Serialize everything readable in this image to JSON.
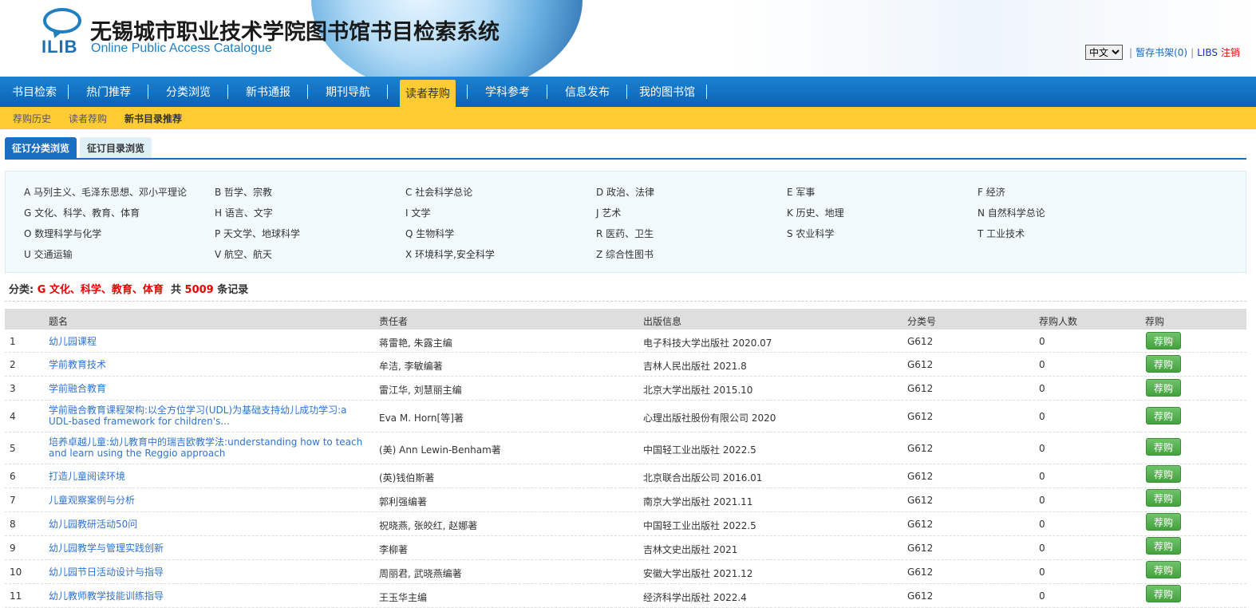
{
  "header": {
    "logo_text": "ILIB",
    "title": "无锡城市职业技术学院图书馆书目检索系统",
    "subtitle": "Online Public Access Catalogue",
    "language": "中文",
    "shelf_link": "暂存书架(0)",
    "libs_link": "LIBS",
    "logout_link": "注销"
  },
  "main_nav": [
    {
      "label": "书目检索",
      "active": false
    },
    {
      "label": "热门推荐",
      "active": false
    },
    {
      "label": "分类浏览",
      "active": false
    },
    {
      "label": "新书通报",
      "active": false
    },
    {
      "label": "期刊导航",
      "active": false
    },
    {
      "label": "读者荐购",
      "active": true
    },
    {
      "label": "学科参考",
      "active": false
    },
    {
      "label": "信息发布",
      "active": false
    },
    {
      "label": "我的图书馆",
      "active": false
    }
  ],
  "sub_nav": [
    {
      "label": "荐购历史"
    },
    {
      "label": "读者荐购"
    },
    {
      "label": "新书目录推荐"
    }
  ],
  "tabs": [
    {
      "label": "征订分类浏览"
    },
    {
      "label": "征订目录浏览"
    }
  ],
  "categories": [
    [
      "A 马列主义、毛泽东思想、邓小平理论",
      "B 哲学、宗教",
      "C 社会科学总论",
      "D 政治、法律",
      "E 军事",
      "F 经济"
    ],
    [
      "G 文化、科学、教育、体育",
      "H 语言、文字",
      "I 文学",
      "J 艺术",
      "K 历史、地理",
      "N 自然科学总论"
    ],
    [
      "O 数理科学与化学",
      "P 天文学、地球科学",
      "Q 生物科学",
      "R 医药、卫生",
      "S 农业科学",
      "T 工业技术"
    ],
    [
      "U 交通运输",
      "V 航空、航天",
      "X 环境科学,安全科学",
      "Z 综合性图书"
    ]
  ],
  "summary": {
    "prefix": "分类:",
    "category": "G 文化、科学、教育、体育",
    "total_prefix": "共",
    "count": "5009",
    "suffix": "条记录"
  },
  "table": {
    "headers": [
      "题名",
      "责任者",
      "出版信息",
      "分类号",
      "荐购人数",
      "荐购"
    ],
    "rows": [
      {
        "no": "1",
        "title": "幼儿园课程",
        "author": "蒋雷艳, 朱露主编",
        "pub": "电子科技大学出版社 2020.07",
        "class": "G612",
        "count": "0",
        "btn": "荐购"
      },
      {
        "no": "2",
        "title": "学前教育技术",
        "author": "牟洁, 李敏编著",
        "pub": "吉林人民出版社 2021.8",
        "class": "G612",
        "count": "0",
        "btn": "荐购"
      },
      {
        "no": "3",
        "title": "学前融合教育",
        "author": "雷江华, 刘慧丽主编",
        "pub": "北京大学出版社 2015.10",
        "class": "G612",
        "count": "0",
        "btn": "荐购"
      },
      {
        "no": "4",
        "title": "学前融合教育课程架构:以全方位学习(UDL)为基础支持幼儿成功学习:a UDL-based framework for children's...",
        "author": "Eva M. Horn[等]著",
        "pub": "心理出版社股份有限公司 2020",
        "class": "G612",
        "count": "0",
        "btn": "荐购"
      },
      {
        "no": "5",
        "title": "培养卓越儿童:幼儿教育中的瑞吉欧教学法:understanding how to teach and learn using the Reggio approach",
        "author": "(美) Ann Lewin-Benham著",
        "pub": "中国轻工业出版社 2022.5",
        "class": "G612",
        "count": "0",
        "btn": "荐购"
      },
      {
        "no": "6",
        "title": "打造儿童阅读环境",
        "author": "(英)钱伯斯著",
        "pub": "北京联合出版公司 2016.01",
        "class": "G612",
        "count": "0",
        "btn": "荐购"
      },
      {
        "no": "7",
        "title": "儿童观察案例与分析",
        "author": "郭利强编著",
        "pub": "南京大学出版社 2021.11",
        "class": "G612",
        "count": "0",
        "btn": "荐购"
      },
      {
        "no": "8",
        "title": "幼儿园教研活动50问",
        "author": "祝晓燕, 张皎红, 赵娜著",
        "pub": "中国轻工业出版社 2022.5",
        "class": "G612",
        "count": "0",
        "btn": "荐购"
      },
      {
        "no": "9",
        "title": "幼儿园教学与管理实践创新",
        "author": "李柳著",
        "pub": "吉林文史出版社 2021",
        "class": "G612",
        "count": "0",
        "btn": "荐购"
      },
      {
        "no": "10",
        "title": "幼儿园节日活动设计与指导",
        "author": "周丽君, 武晓燕编著",
        "pub": "安徽大学出版社 2021.12",
        "class": "G612",
        "count": "0",
        "btn": "荐购"
      },
      {
        "no": "11",
        "title": "幼儿教师教学技能训练指导",
        "author": "王玉华主编",
        "pub": "经济科学出版社 2022.4",
        "class": "G612",
        "count": "0",
        "btn": "荐购"
      }
    ]
  }
}
